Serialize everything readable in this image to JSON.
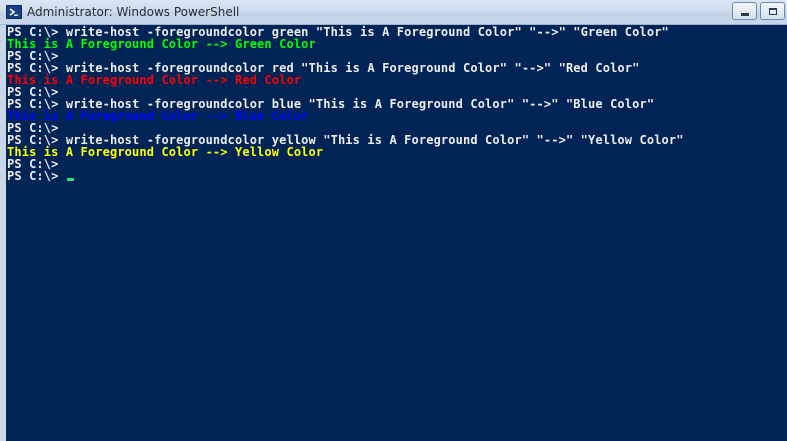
{
  "window": {
    "title": "Administrator: Windows PowerShell",
    "title_bar_color": "#cfdcec",
    "console_background": "#012456"
  },
  "console": {
    "lines": [
      {
        "text": "PS C:\\> write-host -foregroundcolor green \"This is A Foreground Color\" \"-->\" \"Green Color\"",
        "color": "#eeedf0"
      },
      {
        "text": "This is A Foreground Color --> Green Color",
        "color": "#00ff00"
      },
      {
        "text": "PS C:\\>",
        "color": "#eeedf0"
      },
      {
        "text": "PS C:\\> write-host -foregroundcolor red \"This is A Foreground Color\" \"-->\" \"Red Color\"",
        "color": "#eeedf0"
      },
      {
        "text": "This is A Foreground Color --> Red Color",
        "color": "#ff0000"
      },
      {
        "text": "PS C:\\>",
        "color": "#eeedf0"
      },
      {
        "text": "PS C:\\> write-host -foregroundcolor blue \"This is A Foreground Color\" \"-->\" \"Blue Color\"",
        "color": "#eeedf0"
      },
      {
        "text": "This is A Foreground Color --> Blue Color",
        "color": "#0000ff"
      },
      {
        "text": "PS C:\\>",
        "color": "#eeedf0"
      },
      {
        "text": "PS C:\\> write-host -foregroundcolor yellow \"This is A Foreground Color\" \"-->\" \"Yellow Color\"",
        "color": "#eeedf0"
      },
      {
        "text": "This is A Foreground Color --> Yellow Color",
        "color": "#ffff00"
      },
      {
        "text": "PS C:\\>",
        "color": "#eeedf0"
      },
      {
        "text": "PS C:\\>",
        "color": "#eeedf0",
        "cursor": true
      }
    ]
  },
  "icons": {
    "app": "powershell-icon",
    "minimize": "minimize-icon",
    "maximize": "maximize-icon"
  }
}
